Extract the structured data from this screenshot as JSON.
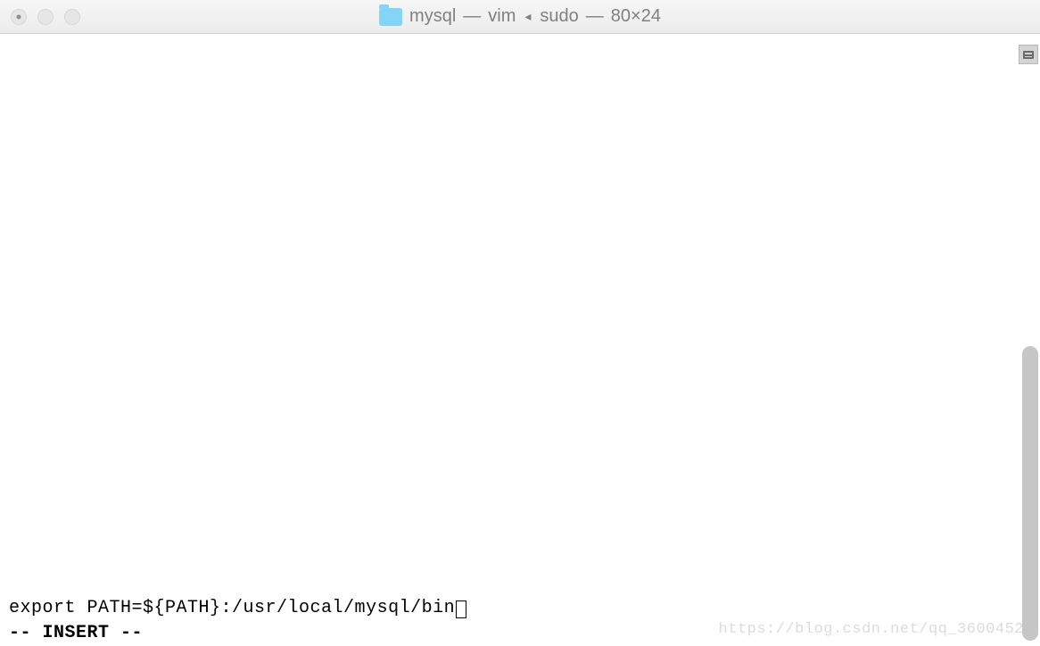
{
  "titlebar": {
    "folder_name": "mysql",
    "process": "vim",
    "parent_process": "sudo",
    "dimensions": "80×24"
  },
  "editor": {
    "content_line": "export PATH=${PATH}:/usr/local/mysql/bin",
    "status_line": "-- INSERT --"
  },
  "watermark": "https://blog.csdn.net/qq_3600452"
}
